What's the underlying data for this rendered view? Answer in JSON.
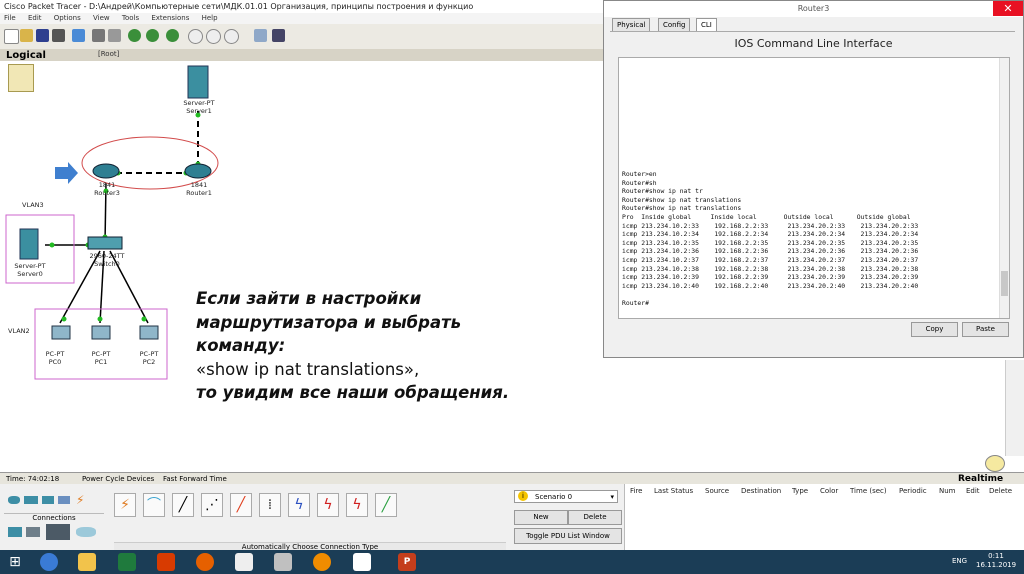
{
  "window": {
    "title": "Cisco Packet Tracer - D:\\Андрей\\Компьютерные сети\\МДК.01.01 Организация, принципы построения и функцио"
  },
  "menu": [
    "File",
    "Edit",
    "Options",
    "View",
    "Tools",
    "Extensions",
    "Help"
  ],
  "workspace": {
    "mode": "Logical",
    "root": "[Root]",
    "devices": {
      "server1": {
        "model": "Server-PT",
        "name": "Server1"
      },
      "router3": {
        "model": "1841",
        "name": "Router3"
      },
      "router1": {
        "model": "1841",
        "name": "Router1"
      },
      "switch0": {
        "model": "2960-24TT",
        "name": "Switch0"
      },
      "server0": {
        "model": "Server-PT",
        "name": "Server0"
      },
      "pc0": {
        "model": "PC-PT",
        "name": "PC0"
      },
      "pc1": {
        "model": "PC-PT",
        "name": "PC1"
      },
      "pc2": {
        "model": "PC-PT",
        "name": "PC2"
      }
    },
    "vlan3": "VLAN3",
    "vlan2": "VLAN2"
  },
  "overlay": {
    "line1": "Если зайти в настройки",
    "line2": "маршрутизатора и выбрать",
    "line3": "команду:",
    "line4": "«show ip nat translations»,",
    "line5": "то увидим все наши обращения."
  },
  "cli_window": {
    "title": "Router3",
    "tabs": [
      "Physical",
      "Config",
      "CLI"
    ],
    "header": "IOS Command Line Interface",
    "output": "Router>en\nRouter#sh\nRouter#show ip nat tr\nRouter#show ip nat translations\nRouter#show ip nat translations\nPro  Inside global     Inside local       Outside local      Outside global\nicmp 213.234.10.2:33    192.168.2.2:33     213.234.20.2:33    213.234.20.2:33\nicmp 213.234.10.2:34    192.168.2.2:34     213.234.20.2:34    213.234.20.2:34\nicmp 213.234.10.2:35    192.168.2.2:35     213.234.20.2:35    213.234.20.2:35\nicmp 213.234.10.2:36    192.168.2.2:36     213.234.20.2:36    213.234.20.2:36\nicmp 213.234.10.2:37    192.168.2.2:37     213.234.20.2:37    213.234.20.2:37\nicmp 213.234.10.2:38    192.168.2.2:38     213.234.20.2:38    213.234.20.2:38\nicmp 213.234.10.2:39    192.168.2.2:39     213.234.20.2:39    213.234.20.2:39\nicmp 213.234.10.2:40    192.168.2.2:40     213.234.20.2:40    213.234.20.2:40\n\nRouter#",
    "copy": "Copy",
    "paste": "Paste"
  },
  "status": {
    "time": "Time: 74:02:18",
    "power_cycle": "Power Cycle Devices",
    "fast_forward": "Fast Forward Time",
    "realtime": "Realtime"
  },
  "bottom": {
    "connections_label": "Connections",
    "conn_type": "Automatically Choose Connection Type",
    "scenario": "Scenario 0",
    "new": "New",
    "delete": "Delete",
    "toggle_pdu": "Toggle PDU List Window",
    "pdu_columns": [
      "Fire",
      "Last Status",
      "Source",
      "Destination",
      "Type",
      "Color",
      "Time (sec)",
      "Periodic",
      "Num",
      "Edit",
      "Delete"
    ]
  },
  "taskbar": {
    "lang": "ENG",
    "time": "0:11",
    "date": "16.11.2019"
  },
  "colors": {
    "taskbar": "#1b3d56",
    "close": "#e81123",
    "link_green": "#22bb22",
    "vlan_box": "#cc66cc"
  }
}
